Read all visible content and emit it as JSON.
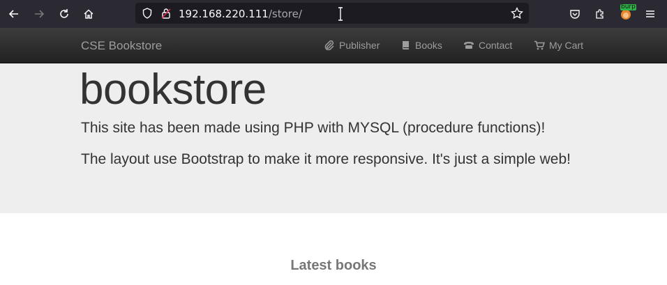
{
  "browser": {
    "url_host": "192.168.220.111",
    "url_path": "/store/",
    "extension_badge": "burp"
  },
  "navbar": {
    "brand": "CSE Bookstore",
    "links": [
      {
        "label": "Publisher",
        "icon": "paperclip-icon"
      },
      {
        "label": "Books",
        "icon": "book-icon"
      },
      {
        "label": "Contact",
        "icon": "phone-icon"
      },
      {
        "label": "My Cart",
        "icon": "cart-icon"
      }
    ]
  },
  "jumbotron": {
    "title": "bookstore",
    "line1": "This site has been made using PHP with MYSQL (procedure functions)!",
    "line2": "The layout use Bootstrap to make it more responsive. It's just a simple web!"
  },
  "main": {
    "section_heading": "Latest books"
  }
}
